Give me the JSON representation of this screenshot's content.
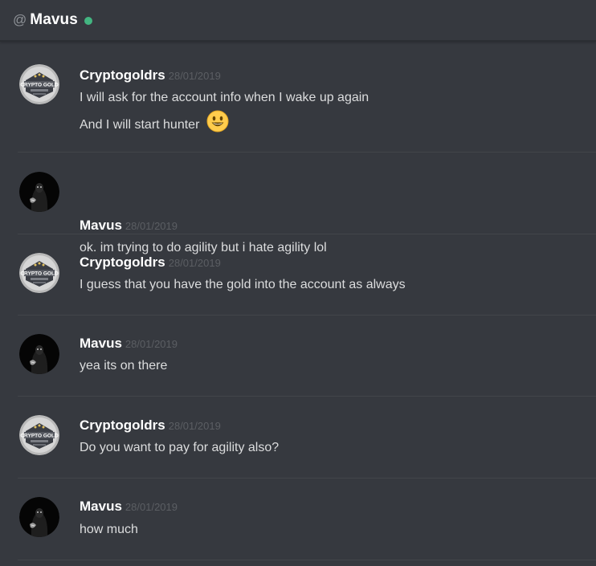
{
  "header": {
    "at_symbol": "@",
    "name": "Mavus",
    "status_color": "#43b581"
  },
  "messages": [
    {
      "author": "Cryptogoldrs",
      "timestamp": "28/01/2019",
      "avatar": "crypto-gold-logo",
      "lines": [
        "I will ask for the account info when I wake up again",
        "And I will start hunter"
      ],
      "emoji": "smiley-emoji"
    },
    {
      "author": "Mavus",
      "timestamp": "28/01/2019",
      "avatar": "dark-character-avatar",
      "lines": [
        "ok. im trying to do agility but i hate agility lol"
      ]
    },
    {
      "author": "Cryptogoldrs",
      "timestamp": "28/01/2019",
      "avatar": "crypto-gold-logo",
      "lines": [
        "I guess that you have the gold into the account as always"
      ]
    },
    {
      "author": "Mavus",
      "timestamp": "28/01/2019",
      "avatar": "dark-character-avatar",
      "lines": [
        "yea its on there"
      ]
    },
    {
      "author": "Cryptogoldrs",
      "timestamp": "28/01/2019",
      "avatar": "crypto-gold-logo",
      "lines": [
        "Do you want to pay for agility also?"
      ]
    },
    {
      "author": "Mavus",
      "timestamp": "28/01/2019",
      "avatar": "dark-character-avatar",
      "lines": [
        "how much"
      ]
    }
  ],
  "avatar_labels": {
    "crypto_gold": "CRYPTO GOLD"
  },
  "colors": {
    "background": "#36393f",
    "username": "#ffffff",
    "timestamp": "#5b5e63",
    "message_text": "#dcddde",
    "online": "#43b581"
  }
}
